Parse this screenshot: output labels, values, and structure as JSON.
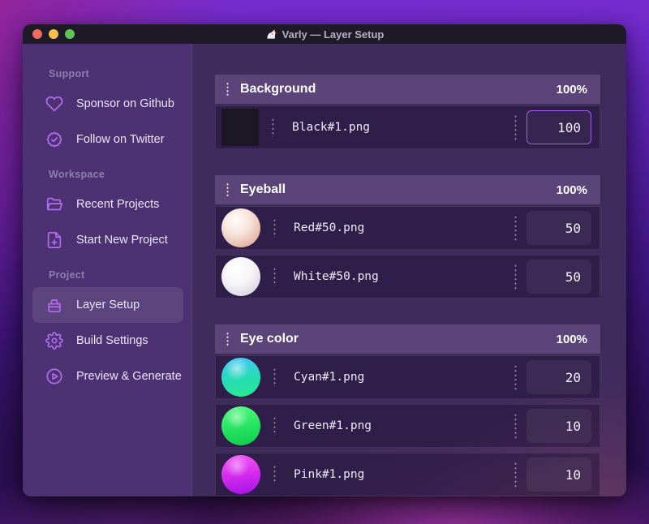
{
  "titlebar": {
    "title": "Varly — Layer Setup",
    "app_icon": "unicorn-icon",
    "traffic_lights": [
      "close",
      "minimize",
      "zoom"
    ]
  },
  "sidebar": {
    "sections": [
      {
        "label": "Support",
        "items": [
          {
            "label": "Sponsor on Github",
            "icon": "heart-icon",
            "active": false
          },
          {
            "label": "Follow on Twitter",
            "icon": "verified-badge-icon",
            "active": false
          }
        ]
      },
      {
        "label": "Workspace",
        "items": [
          {
            "label": "Recent Projects",
            "icon": "folder-icon",
            "active": false
          },
          {
            "label": "Start New Project",
            "icon": "file-plus-icon",
            "active": false
          }
        ]
      },
      {
        "label": "Project",
        "items": [
          {
            "label": "Layer Setup",
            "icon": "archive-box-icon",
            "active": true
          },
          {
            "label": "Build Settings",
            "icon": "gear-icon",
            "active": false
          },
          {
            "label": "Preview & Generate",
            "icon": "play-circle-icon",
            "active": false
          }
        ]
      }
    ]
  },
  "layers": {
    "groups": [
      {
        "name": "Background",
        "weight": "100%",
        "items": [
          {
            "file": "Black#1.png",
            "value": "100",
            "thumb": "black-square",
            "focused": true
          }
        ]
      },
      {
        "name": "Eyeball",
        "weight": "100%",
        "items": [
          {
            "file": "Red#50.png",
            "value": "50",
            "thumb": "red-ball",
            "focused": false
          },
          {
            "file": "White#50.png",
            "value": "50",
            "thumb": "white-ball",
            "focused": false
          }
        ]
      },
      {
        "name": "Eye color",
        "weight": "100%",
        "items": [
          {
            "file": "Cyan#1.png",
            "value": "20",
            "thumb": "cyan-ball",
            "focused": false
          },
          {
            "file": "Green#1.png",
            "value": "10",
            "thumb": "green-ball",
            "focused": false
          },
          {
            "file": "Pink#1.png",
            "value": "10",
            "thumb": "pink-ball",
            "focused": false
          }
        ]
      }
    ]
  },
  "colors": {
    "accent_purple": "#b16ceb",
    "focused_input_border": "#a55fe6",
    "sidebar_bg": "#4c3272",
    "content_bg": "#3f2b5c",
    "group_header_bg": "#5b4578",
    "titlebar_bg": "#1f1a28",
    "traffic_close": "#ee6a5f",
    "traffic_min": "#f5bf4f",
    "traffic_zoom": "#61c554",
    "thumb_black": "#1c1723",
    "thumb_cyan_top": "#3fc8f2",
    "thumb_cyan_bottom": "#27e897",
    "thumb_green": "#20e15c",
    "thumb_pink": "#d42bee"
  }
}
